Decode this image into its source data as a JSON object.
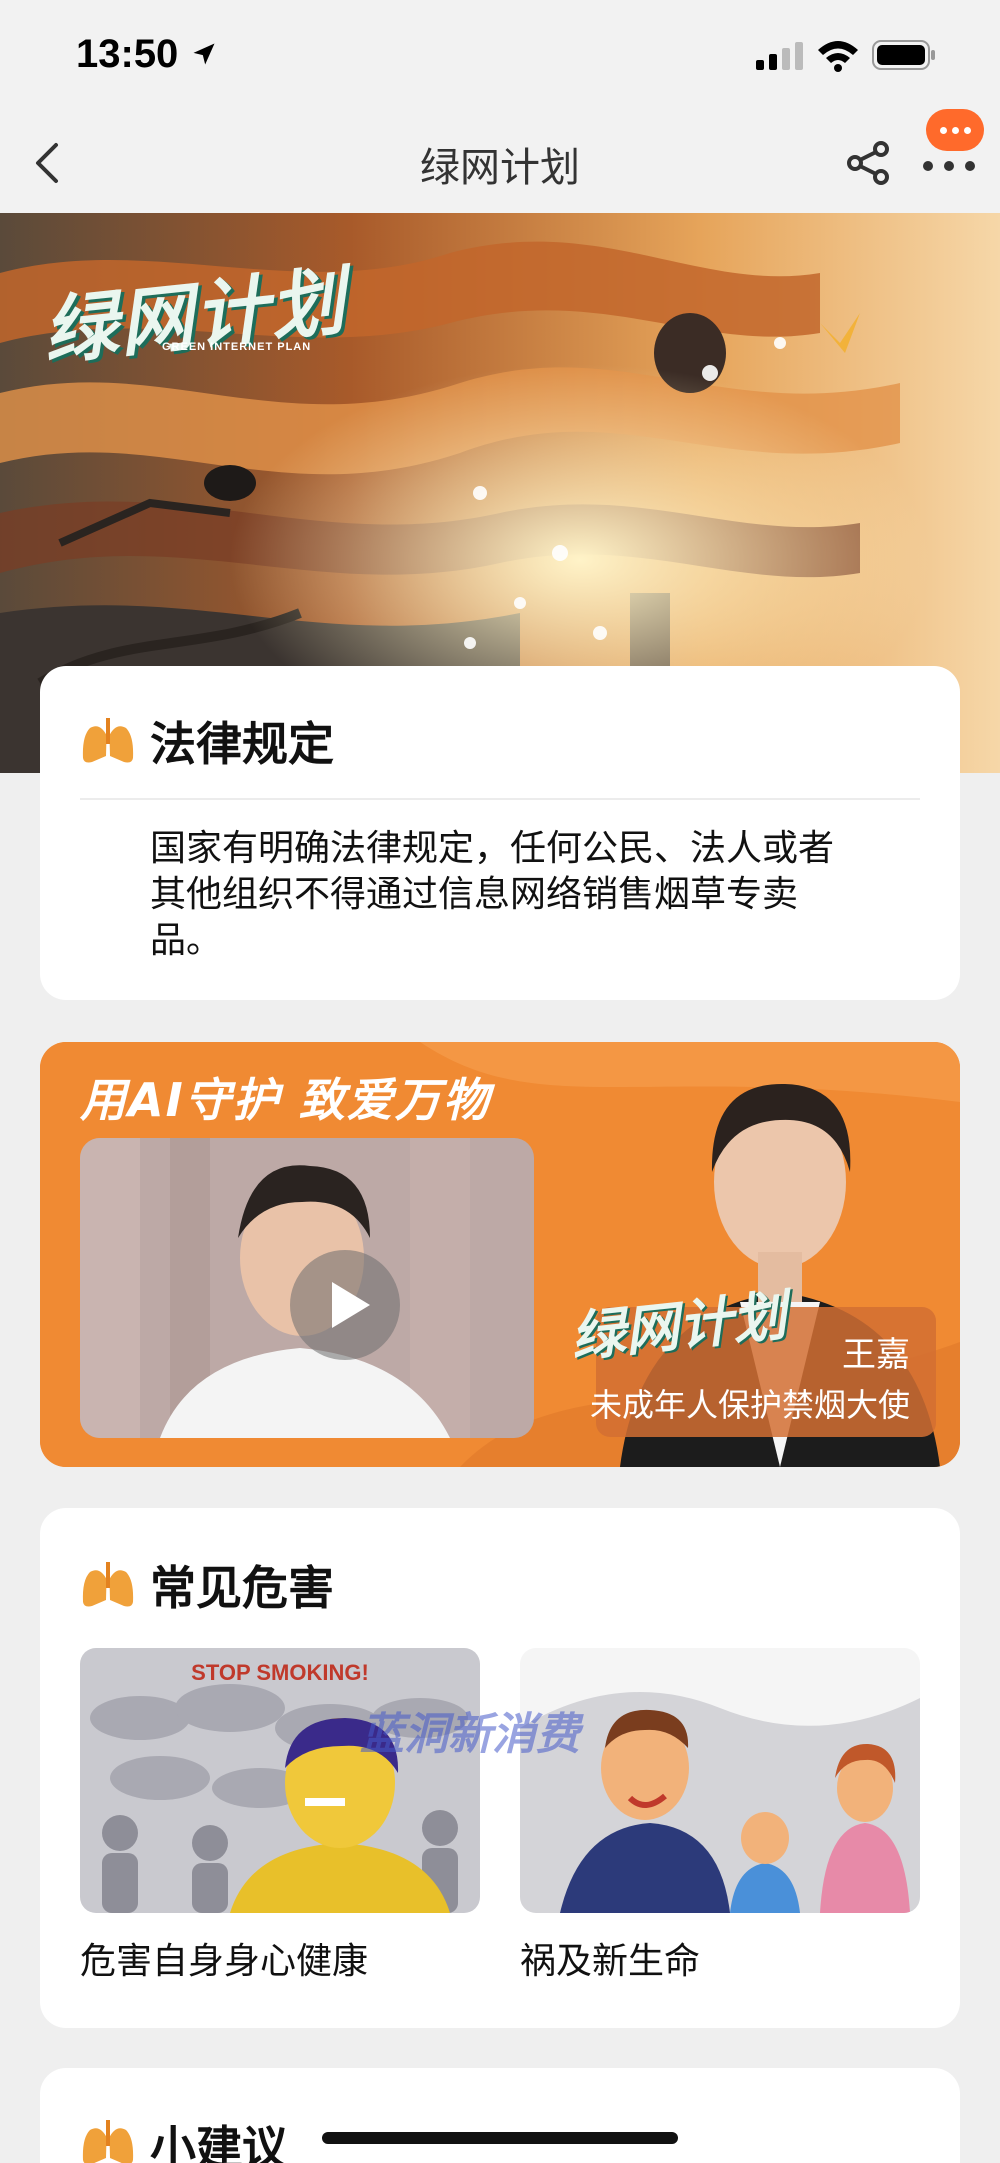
{
  "status_bar": {
    "time": "13:50"
  },
  "nav": {
    "title": "绿网计划"
  },
  "banner": {
    "logo_text": "绿网计划",
    "logo_subtitle": "GREEN INTERNET PLAN"
  },
  "law_section": {
    "title": "法律规定",
    "body": "国家有明确法律规定，任何公民、法人或者其他组织不得通过信息网络销售烟草专卖品。"
  },
  "promo": {
    "slogan": "用AI守护  致爱万物",
    "logo_text": "绿网计划",
    "name": "王嘉",
    "role": "未成年人保护禁烟大使"
  },
  "hazards": {
    "title": "常见危害",
    "watermark": "蓝洞新消费",
    "items": [
      {
        "label": "危害自身身心健康",
        "image_caption": "STOP SMOKING!"
      },
      {
        "label": "祸及新生命"
      }
    ]
  },
  "advice": {
    "title": "小建议"
  },
  "colors": {
    "accent_orange": "#f08a33",
    "badge_orange": "#ff6a2b",
    "page_bg": "#efefef"
  },
  "icons": [
    "location-arrow-icon",
    "signal-icon",
    "wifi-icon",
    "battery-icon",
    "back-icon",
    "share-icon",
    "more-icon",
    "lung-icon",
    "play-icon"
  ]
}
